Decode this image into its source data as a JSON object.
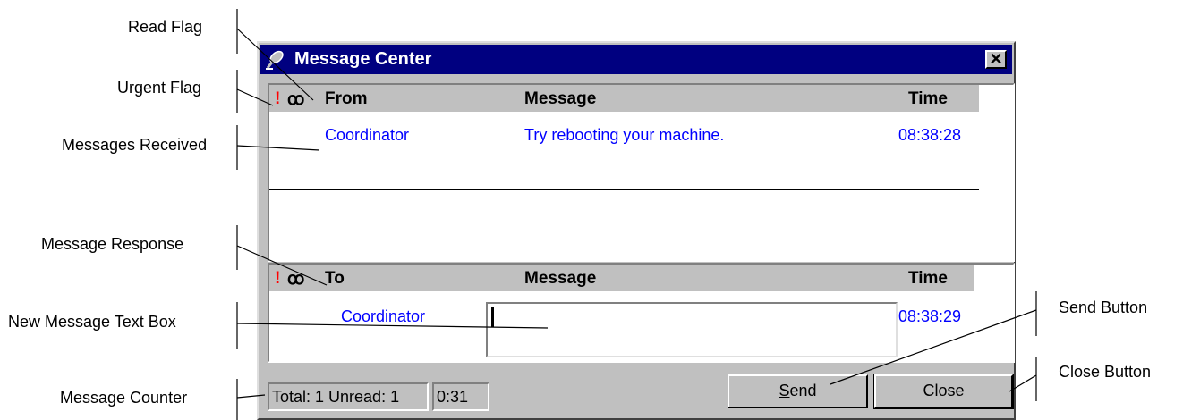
{
  "callouts": {
    "read_flag": "Read Flag",
    "urgent_flag": "Urgent Flag",
    "messages_received": "Messages Received",
    "message_response": "Message Response",
    "new_message_text_box": "New Message Text Box",
    "message_counter": "Message Counter",
    "send_button": "Send Button",
    "close_button": "Close Button"
  },
  "window": {
    "title": "Message Center",
    "close_glyph": "✕"
  },
  "received": {
    "header": {
      "urgent_flag": "!",
      "read_flag": "ꝏ",
      "from": "From",
      "message": "Message",
      "time": "Time"
    },
    "rows": [
      {
        "from": "Coordinator",
        "message": "Try rebooting your machine.",
        "time": "08:38:28"
      }
    ]
  },
  "response": {
    "header": {
      "urgent_flag": "!",
      "read_flag": "ꝏ",
      "to": "To",
      "message": "Message",
      "time": "Time"
    },
    "to": "Coordinator",
    "message_value": "",
    "time": "08:38:29"
  },
  "status": {
    "counter": "Total: 1 Unread: 1",
    "elapsed": "0:31"
  },
  "buttons": {
    "send_mnemonic": "S",
    "send_rest": "end",
    "close": "Close"
  },
  "colors": {
    "titlebar": "#000080",
    "row_text": "#0000ff",
    "urgent_flag": "#ff0000",
    "face": "#c0c0c0"
  }
}
